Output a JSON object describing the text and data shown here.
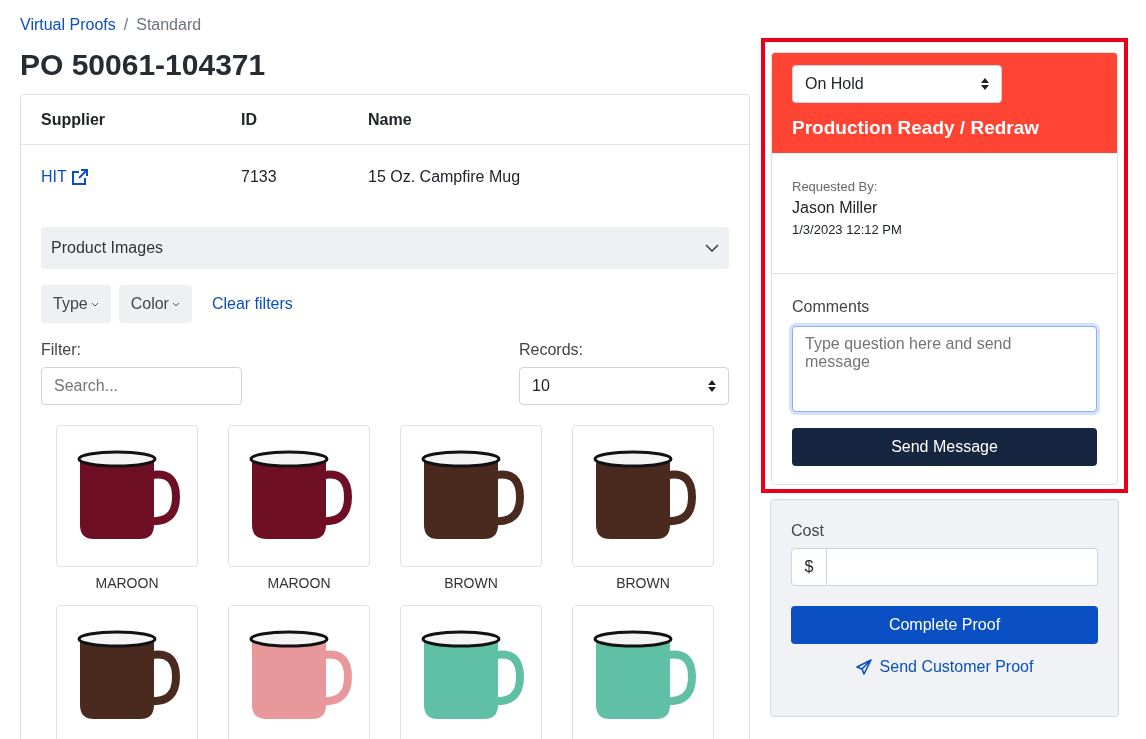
{
  "breadcrumb": [
    {
      "label": "Virtual Proofs",
      "kind": "link"
    },
    {
      "label": "/",
      "kind": "separator"
    },
    {
      "label": "Standard",
      "kind": "current"
    }
  ],
  "title": "PO 50061-104371",
  "table": {
    "columns": [
      "Supplier",
      "ID",
      "Name"
    ],
    "rows": [
      {
        "supplier": "HIT",
        "id": "7133",
        "name": "15 Oz. Campfire Mug"
      }
    ]
  },
  "product_images": {
    "label": "Product Images",
    "expanded": false
  },
  "filters": {
    "buttons": [
      "Type",
      "Color"
    ],
    "clear": "Clear filters",
    "filter_label": "Filter:",
    "search_placeholder": "Search...",
    "records_label": "Records:",
    "records_value": "10"
  },
  "images": [
    {
      "label": "MAROON",
      "color": "#6e0f25"
    },
    {
      "label": "MAROON",
      "color": "#6e0f25"
    },
    {
      "label": "BROWN",
      "color": "#4a2a1e"
    },
    {
      "label": "BROWN",
      "color": "#4a2a1e"
    },
    {
      "color": "#4a2a1e"
    },
    {
      "color": "#e8989a"
    },
    {
      "color": "#5fc0a6"
    },
    {
      "color": "#5fc0a6"
    }
  ],
  "status_panel": {
    "status": "On Hold",
    "heading": "Production Ready / Redraw",
    "requested_by_label": "Requested By:",
    "requested_by": "Jason Miller",
    "requested_at": "1/3/2023 12:12 PM",
    "comments_label": "Comments",
    "comments_placeholder": "Type question here and send message",
    "send_button": "Send Message"
  },
  "cost_panel": {
    "label": "Cost",
    "prefix": "$",
    "complete_button": "Complete Proof",
    "send_link": "Send Customer Proof"
  }
}
